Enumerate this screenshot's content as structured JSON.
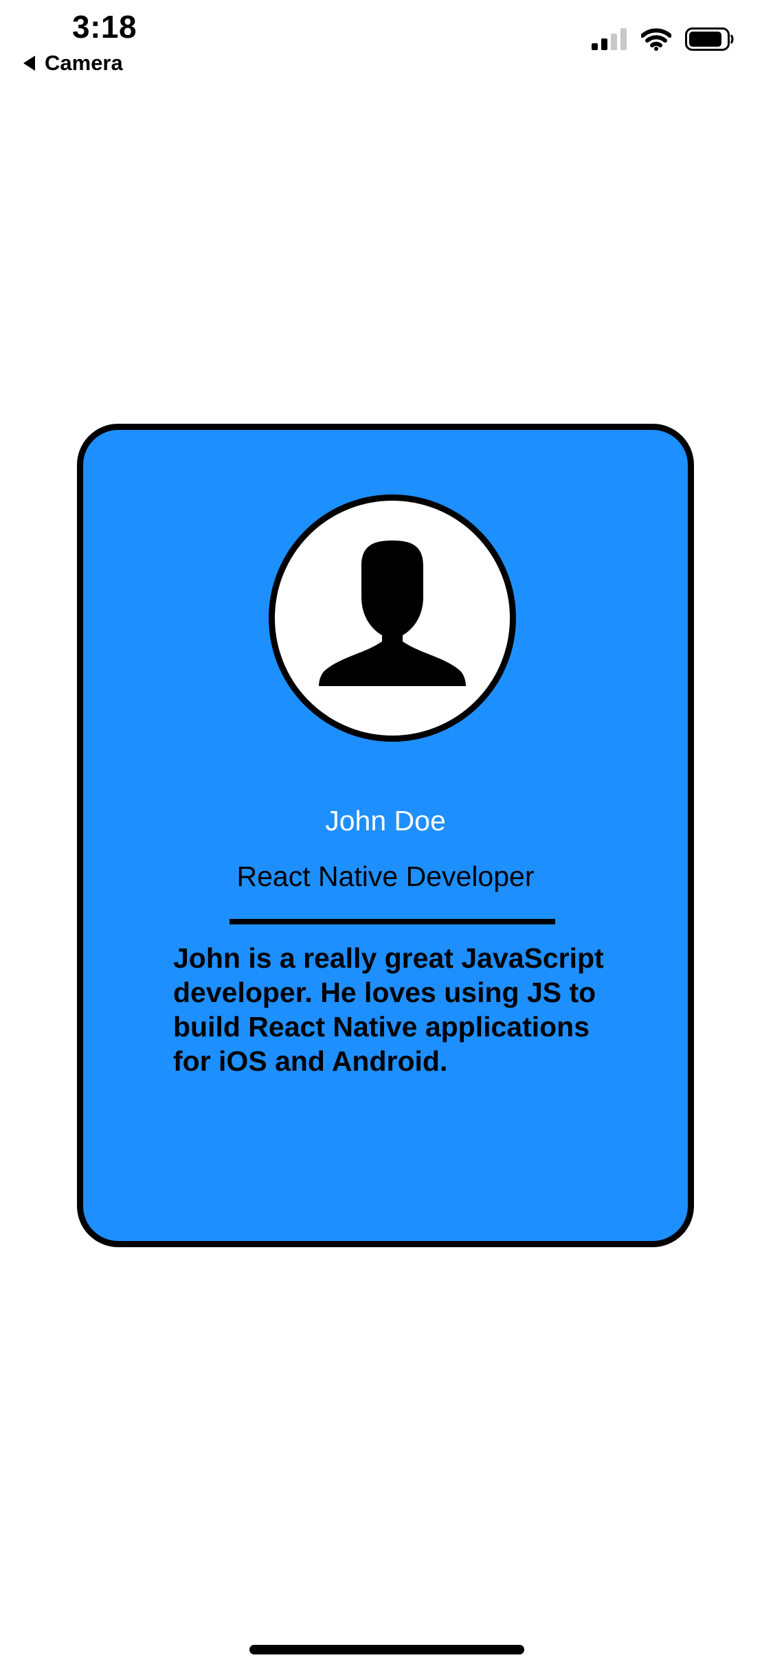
{
  "status_bar": {
    "time": "3:18",
    "back_label": "Camera",
    "icons": [
      "cellular-signal-icon",
      "wifi-icon",
      "battery-icon"
    ]
  },
  "card": {
    "background_color": "#1e8fff",
    "avatar_icon": "person-silhouette-icon",
    "name": "John Doe",
    "role": "React Native Developer",
    "bio": "John is a really great JavaScript developer. He loves using JS to build React Native applications for iOS and Android."
  }
}
